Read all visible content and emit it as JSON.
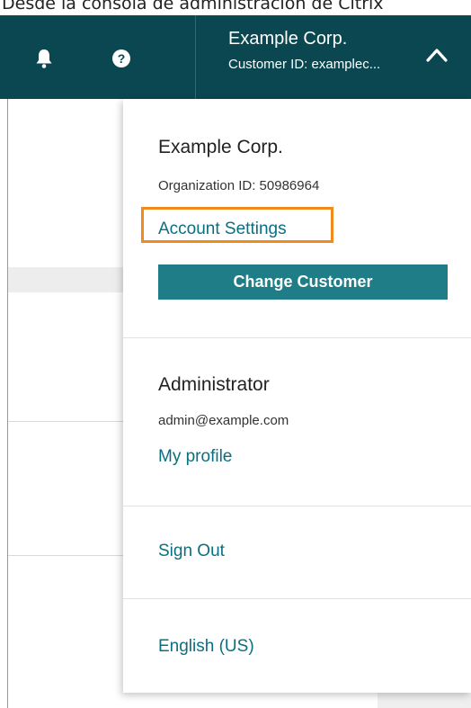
{
  "caption": "Desde la consola de administración de Citrix",
  "header": {
    "bell_icon": "bell-icon",
    "help_icon": "question-circle-icon",
    "org_name": "Example Corp.",
    "customer_id": "Customer ID: examplec...",
    "chevron_icon": "chevron-up-icon",
    "background_color": "#0a4750"
  },
  "menu": {
    "org_name": "Example Corp.",
    "org_id": "Organization ID: 50986964",
    "account_settings": "Account Settings",
    "change_customer": "Change Customer",
    "user_role": "Administrator",
    "user_email": "admin@example.com",
    "my_profile": "My profile",
    "sign_out": "Sign Out",
    "language": "English (US)",
    "link_color": "#0a6f80",
    "button_color": "#1e7d86",
    "highlight_color": "#f08a1c"
  }
}
